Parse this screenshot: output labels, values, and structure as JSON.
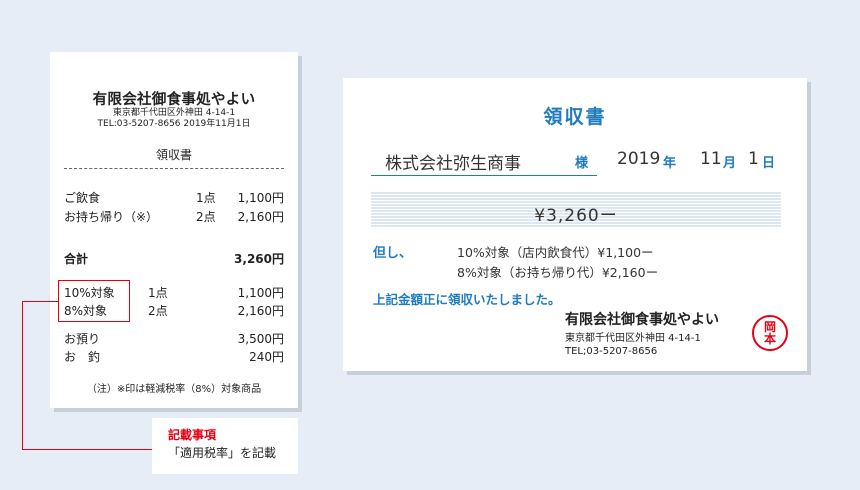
{
  "receipt": {
    "shop_name": "有限会社御食事処やよい",
    "address": "東京都千代田区外神田 4-14-1",
    "tel_date": "TEL:03-5207-8656 2019年11月1日",
    "heading": "領収書",
    "items": [
      {
        "name": "ご飲食",
        "qty": "1点",
        "price": "1,100円"
      },
      {
        "name": "お持ち帰り（※）",
        "qty": "2点",
        "price": "2,160円"
      }
    ],
    "total_label": "合計",
    "total_value": "3,260円",
    "tax_rows": [
      {
        "label": "10%対象",
        "qty": "1点",
        "amount": "1,100円"
      },
      {
        "label": "8%対象",
        "qty": "2点",
        "amount": "2,160円"
      }
    ],
    "deposit_label": "お預り",
    "deposit_value": "3,500円",
    "change_label": "お　釣",
    "change_value": "240円",
    "note": "（注）※印は軽減税率（8%）対象商品"
  },
  "callout": {
    "title": "記載事項",
    "text": "「適用税率」を記載"
  },
  "invoice": {
    "title": "領収書",
    "recipient": "株式会社弥生商事",
    "honorific": "様",
    "date_year": "2019",
    "date_year_unit": "年",
    "date_month": "11",
    "date_month_unit": "月",
    "date_day": "1",
    "date_day_unit": "日",
    "amount": "¥3,260ー",
    "tadashi_label": "但し、",
    "lines": [
      "10%対象（店内飲食代）¥1,100ー",
      "8%対象（お持ち帰り代）¥2,160ー"
    ],
    "received_text": "上記金額正に領収いたしました。",
    "issuer_name": "有限会社御食事処やよい",
    "issuer_address": "東京都千代田区外神田 4-14-1",
    "issuer_tel": "TEL;03-5207-8656",
    "seal_top": "岡",
    "seal_bottom": "本"
  },
  "colors": {
    "accent_blue": "#1f7bbf",
    "highlight_red": "#e60012",
    "background": "#e7edf6"
  }
}
